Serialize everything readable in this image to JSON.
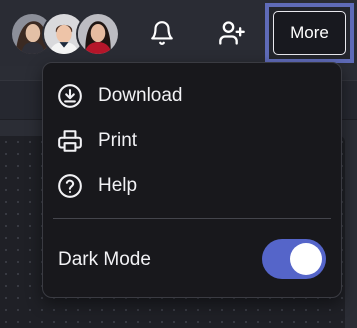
{
  "header": {
    "avatars": [
      {
        "name": "user-avatar-1"
      },
      {
        "name": "user-avatar-2"
      },
      {
        "name": "user-avatar-3"
      }
    ],
    "bell_icon": "bell-icon",
    "add_user_icon": "add-user-icon",
    "more_label": "More"
  },
  "menu": {
    "items": [
      {
        "label": "Download",
        "icon": "download-icon"
      },
      {
        "label": "Print",
        "icon": "printer-icon"
      },
      {
        "label": "Help",
        "icon": "help-icon"
      }
    ],
    "dark_mode": {
      "label": "Dark Mode",
      "on": true
    }
  },
  "colors": {
    "accent": "#5565c9",
    "focus_ring": "#5f6bb8",
    "menu_bg": "#18181c"
  }
}
